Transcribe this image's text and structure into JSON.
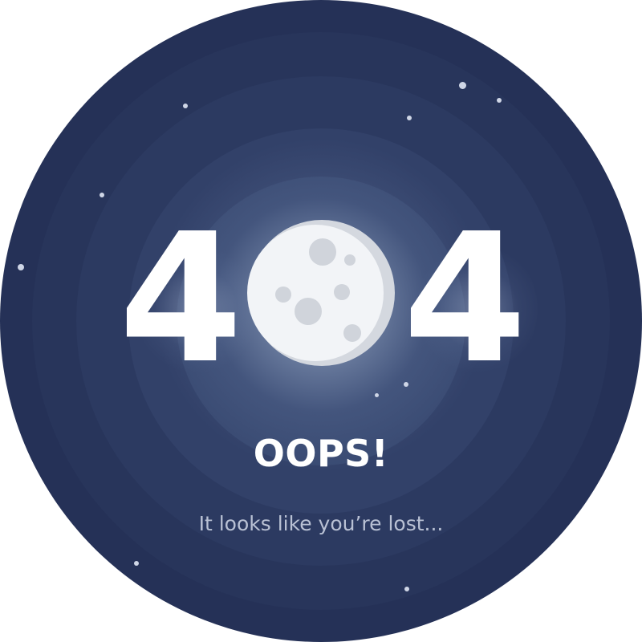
{
  "error_code": {
    "first_digit": "4",
    "middle_glyph": "moon-icon",
    "last_digit": "4"
  },
  "headline": "OOPS!",
  "message": "It looks like you’re lost...",
  "colors": {
    "background_outer": "#253157",
    "background_inner": "#394a72",
    "text_primary": "#ffffff",
    "text_secondary": "#b9c1d4",
    "moon": "#f2f4f7",
    "moon_shadow": "#d4d8df",
    "crater": "#d0d4db",
    "star": "#cfd6e6"
  }
}
